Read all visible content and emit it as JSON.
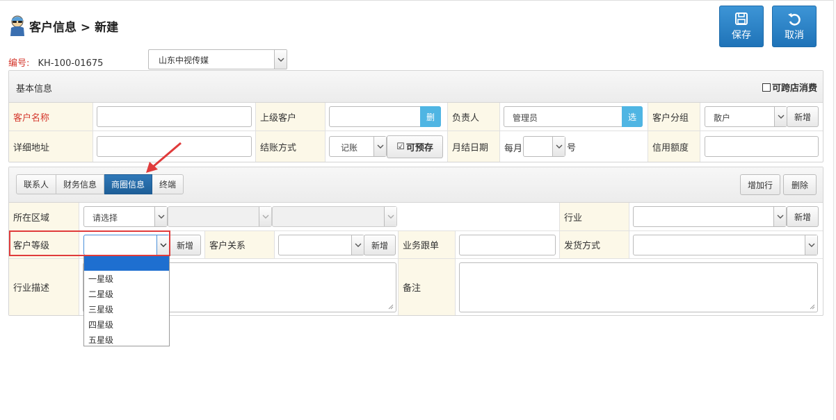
{
  "header": {
    "title": "客户信息 > 新建",
    "logo_icon": "mascot-icon"
  },
  "toolbar": {
    "save_label": "保存",
    "cancel_label": "取消",
    "accent": "#2a84c7"
  },
  "code": {
    "label": "编号:",
    "value": "KH-100-01675"
  },
  "company": {
    "selected": "山东中视传媒"
  },
  "basic": {
    "section_title": "基本信息",
    "cross_store_label": "可跨店消费",
    "customer_name_label": "客户名称",
    "parent_customer_label": "上级客户",
    "parent_btn": "删",
    "owner_label": "负责人",
    "owner_value": "管理员",
    "owner_btn": "选",
    "group_label": "客户分组",
    "group_value": "散户",
    "group_add": "新增",
    "address_label": "详细地址",
    "settle_label": "结账方式",
    "settle_value": "记账",
    "prepay_label": "可预存",
    "monthly_label": "月结日期",
    "monthly_prefix": "每月",
    "monthly_suffix": "号",
    "credit_label": "信用额度"
  },
  "tabs": {
    "contact": "联系人",
    "finance": "财务信息",
    "business": "商圈信息",
    "terminal": "终端",
    "add_row": "增加行",
    "delete": "删除"
  },
  "business": {
    "region_label": "所在区域",
    "region_value": "请选择",
    "industry_label": "行业",
    "industry_add": "新增",
    "level_label": "客户等级",
    "level_add": "新增",
    "relation_label": "客户关系",
    "relation_add": "新增",
    "follow_label": "业务跟单",
    "shipping_label": "发货方式",
    "desc_label": "行业描述",
    "remark_label": "备注"
  },
  "level_options": [
    "",
    "一星级",
    "二星级",
    "三星级",
    "四星级",
    "五星级"
  ]
}
